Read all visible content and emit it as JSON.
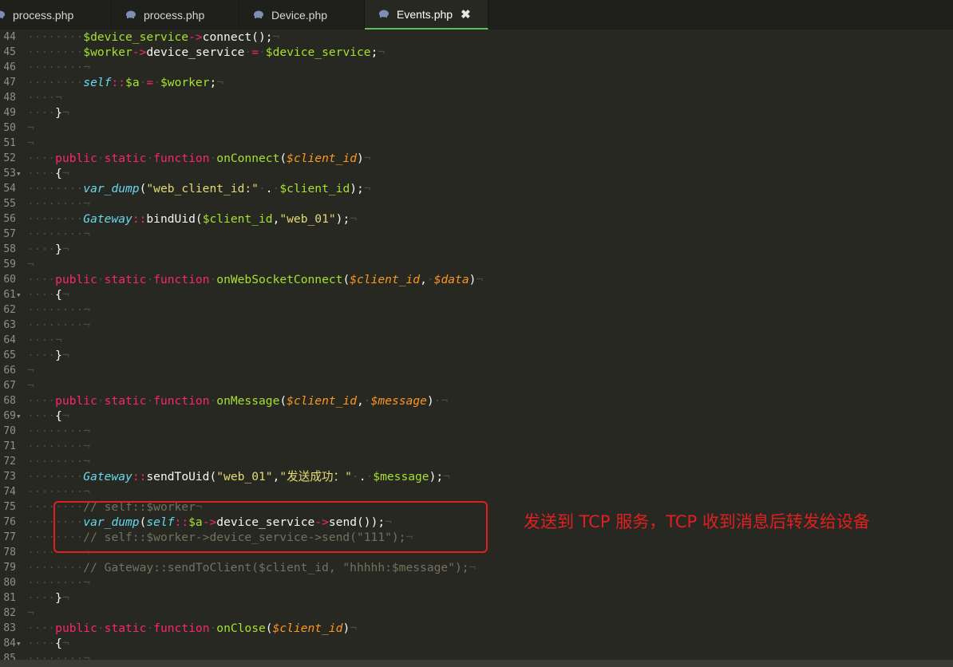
{
  "tabs": [
    {
      "label": "process.php",
      "active": false
    },
    {
      "label": "process.php",
      "active": false
    },
    {
      "label": "Device.php",
      "active": false
    },
    {
      "label": "Events.php",
      "active": true
    }
  ],
  "close_glyph": "✖",
  "annotation": "发送到 TCP 服务，TCP 收到消息后转发给设备",
  "colors": {
    "background": "#272822",
    "keyword": "#f92672",
    "function": "#a6e22e",
    "string": "#e6db74",
    "comment": "#75715e",
    "annotation": "#e02020",
    "active_tab_underline": "#5ac15a"
  },
  "lines": [
    {
      "n": "44",
      "fold": "",
      "segs": [
        [
          "ws",
          "········"
        ],
        [
          "var",
          "$device_service"
        ],
        [
          "op",
          "->"
        ],
        [
          "plain",
          "connect();"
        ],
        [
          "ws",
          "¬"
        ]
      ]
    },
    {
      "n": "45",
      "fold": "",
      "segs": [
        [
          "ws",
          "········"
        ],
        [
          "var",
          "$worker"
        ],
        [
          "op",
          "->"
        ],
        [
          "plain",
          "device_service"
        ],
        [
          "ws",
          "·"
        ],
        [
          "op",
          "="
        ],
        [
          "ws",
          "·"
        ],
        [
          "var",
          "$device_service"
        ],
        [
          "plain",
          ";"
        ],
        [
          "ws",
          "¬"
        ]
      ]
    },
    {
      "n": "46",
      "fold": "",
      "segs": [
        [
          "ws",
          "········¬"
        ]
      ]
    },
    {
      "n": "47",
      "fold": "",
      "segs": [
        [
          "ws",
          "········"
        ],
        [
          "st",
          "self"
        ],
        [
          "op",
          "::"
        ],
        [
          "var",
          "$a"
        ],
        [
          "ws",
          "·"
        ],
        [
          "op",
          "="
        ],
        [
          "ws",
          "·"
        ],
        [
          "var",
          "$worker"
        ],
        [
          "plain",
          ";"
        ],
        [
          "ws",
          "¬"
        ]
      ]
    },
    {
      "n": "48",
      "fold": "",
      "segs": [
        [
          "ws",
          "····¬"
        ]
      ]
    },
    {
      "n": "49",
      "fold": "",
      "segs": [
        [
          "ws",
          "····"
        ],
        [
          "plain",
          "}"
        ],
        [
          "ws",
          "¬"
        ]
      ]
    },
    {
      "n": "50",
      "fold": "",
      "segs": [
        [
          "ws",
          "¬"
        ]
      ]
    },
    {
      "n": "51",
      "fold": "",
      "segs": [
        [
          "ws",
          "¬"
        ]
      ]
    },
    {
      "n": "52",
      "fold": "",
      "segs": [
        [
          "ws",
          "····"
        ],
        [
          "kw",
          "public"
        ],
        [
          "ws",
          "·"
        ],
        [
          "kw",
          "static"
        ],
        [
          "ws",
          "·"
        ],
        [
          "kw",
          "function"
        ],
        [
          "ws",
          "·"
        ],
        [
          "fn",
          "onConnect"
        ],
        [
          "plain",
          "("
        ],
        [
          "ph",
          "$client_id"
        ],
        [
          "plain",
          ")"
        ],
        [
          "ws",
          "¬"
        ]
      ]
    },
    {
      "n": "53",
      "fold": "▾",
      "segs": [
        [
          "ws",
          "····"
        ],
        [
          "plain",
          "{"
        ],
        [
          "ws",
          "¬"
        ]
      ]
    },
    {
      "n": "54",
      "fold": "",
      "segs": [
        [
          "ws",
          "········"
        ],
        [
          "st",
          "var_dump"
        ],
        [
          "plain",
          "("
        ],
        [
          "str",
          "\"web_client_id:\""
        ],
        [
          "ws",
          "·"
        ],
        [
          "plain",
          "."
        ],
        [
          "ws",
          "·"
        ],
        [
          "var",
          "$client_id"
        ],
        [
          "plain",
          ");"
        ],
        [
          "ws",
          "¬"
        ]
      ]
    },
    {
      "n": "55",
      "fold": "",
      "segs": [
        [
          "ws",
          "········¬"
        ]
      ]
    },
    {
      "n": "56",
      "fold": "",
      "segs": [
        [
          "ws",
          "········"
        ],
        [
          "st",
          "Gateway"
        ],
        [
          "op",
          "::"
        ],
        [
          "plain",
          "bindUid("
        ],
        [
          "var",
          "$client_id"
        ],
        [
          "plain",
          ","
        ],
        [
          "str",
          "\"web_01\""
        ],
        [
          "plain",
          ");"
        ],
        [
          "ws",
          "¬"
        ]
      ]
    },
    {
      "n": "57",
      "fold": "",
      "segs": [
        [
          "ws",
          "········¬"
        ]
      ]
    },
    {
      "n": "58",
      "fold": "",
      "segs": [
        [
          "ws",
          "····"
        ],
        [
          "plain",
          "}"
        ],
        [
          "ws",
          "¬"
        ]
      ]
    },
    {
      "n": "59",
      "fold": "",
      "segs": [
        [
          "ws",
          "¬"
        ]
      ]
    },
    {
      "n": "60",
      "fold": "",
      "segs": [
        [
          "ws",
          "····"
        ],
        [
          "kw",
          "public"
        ],
        [
          "ws",
          "·"
        ],
        [
          "kw",
          "static"
        ],
        [
          "ws",
          "·"
        ],
        [
          "kw",
          "function"
        ],
        [
          "ws",
          "·"
        ],
        [
          "fn",
          "onWebSocketConnect"
        ],
        [
          "plain",
          "("
        ],
        [
          "ph",
          "$client_id"
        ],
        [
          "plain",
          ","
        ],
        [
          "ws",
          "·"
        ],
        [
          "ph",
          "$data"
        ],
        [
          "plain",
          ")"
        ],
        [
          "ws",
          "¬"
        ]
      ]
    },
    {
      "n": "61",
      "fold": "▾",
      "segs": [
        [
          "ws",
          "····"
        ],
        [
          "plain",
          "{"
        ],
        [
          "ws",
          "¬"
        ]
      ]
    },
    {
      "n": "62",
      "fold": "",
      "segs": [
        [
          "ws",
          "········¬"
        ]
      ]
    },
    {
      "n": "63",
      "fold": "",
      "segs": [
        [
          "ws",
          "········¬"
        ]
      ]
    },
    {
      "n": "64",
      "fold": "",
      "segs": [
        [
          "ws",
          "····¬"
        ]
      ]
    },
    {
      "n": "65",
      "fold": "",
      "segs": [
        [
          "ws",
          "····"
        ],
        [
          "plain",
          "}"
        ],
        [
          "ws",
          "¬"
        ]
      ]
    },
    {
      "n": "66",
      "fold": "",
      "segs": [
        [
          "ws",
          "¬"
        ]
      ]
    },
    {
      "n": "67",
      "fold": "",
      "segs": [
        [
          "ws",
          "¬"
        ]
      ]
    },
    {
      "n": "68",
      "fold": "",
      "segs": [
        [
          "ws",
          "····"
        ],
        [
          "kw",
          "public"
        ],
        [
          "ws",
          "·"
        ],
        [
          "kw",
          "static"
        ],
        [
          "ws",
          "·"
        ],
        [
          "kw",
          "function"
        ],
        [
          "ws",
          "·"
        ],
        [
          "fn",
          "onMessage"
        ],
        [
          "plain",
          "("
        ],
        [
          "ph",
          "$client_id"
        ],
        [
          "plain",
          ","
        ],
        [
          "ws",
          "·"
        ],
        [
          "ph",
          "$message"
        ],
        [
          "plain",
          ")"
        ],
        [
          "ws",
          "·¬"
        ]
      ]
    },
    {
      "n": "69",
      "fold": "▾",
      "segs": [
        [
          "ws",
          "····"
        ],
        [
          "plain",
          "{"
        ],
        [
          "ws",
          "¬"
        ]
      ]
    },
    {
      "n": "70",
      "fold": "",
      "segs": [
        [
          "ws",
          "········¬"
        ]
      ]
    },
    {
      "n": "71",
      "fold": "",
      "segs": [
        [
          "ws",
          "········¬"
        ]
      ]
    },
    {
      "n": "72",
      "fold": "",
      "segs": [
        [
          "ws",
          "········¬"
        ]
      ]
    },
    {
      "n": "73",
      "fold": "",
      "segs": [
        [
          "ws",
          "········"
        ],
        [
          "st",
          "Gateway"
        ],
        [
          "op",
          "::"
        ],
        [
          "plain",
          "sendToUid("
        ],
        [
          "str",
          "\"web_01\""
        ],
        [
          "plain",
          ","
        ],
        [
          "str",
          "\"发送成功：\""
        ],
        [
          "ws",
          "·"
        ],
        [
          "plain",
          "."
        ],
        [
          "ws",
          "·"
        ],
        [
          "var",
          "$message"
        ],
        [
          "plain",
          ");"
        ],
        [
          "ws",
          "¬"
        ]
      ]
    },
    {
      "n": "74",
      "fold": "",
      "segs": [
        [
          "ws",
          "········¬"
        ]
      ]
    },
    {
      "n": "75",
      "fold": "",
      "segs": [
        [
          "ws",
          "········"
        ],
        [
          "cm",
          "// self::$worker"
        ],
        [
          "ws",
          "¬"
        ]
      ]
    },
    {
      "n": "76",
      "fold": "",
      "segs": [
        [
          "ws",
          "········"
        ],
        [
          "st",
          "var_dump"
        ],
        [
          "plain",
          "("
        ],
        [
          "st",
          "self"
        ],
        [
          "op",
          "::"
        ],
        [
          "var",
          "$a"
        ],
        [
          "op",
          "->"
        ],
        [
          "plain",
          "device_service"
        ],
        [
          "op",
          "->"
        ],
        [
          "plain",
          "send());"
        ],
        [
          "ws",
          "¬"
        ]
      ]
    },
    {
      "n": "77",
      "fold": "",
      "segs": [
        [
          "ws",
          "········"
        ],
        [
          "cm",
          "// self::$worker->device_service->send(\"111\");"
        ],
        [
          "ws",
          "¬"
        ]
      ]
    },
    {
      "n": "78",
      "fold": "",
      "segs": [
        [
          "ws",
          "········¬"
        ]
      ]
    },
    {
      "n": "79",
      "fold": "",
      "segs": [
        [
          "ws",
          "········"
        ],
        [
          "cm",
          "// Gateway::sendToClient($client_id, \"hhhhh:$message\");"
        ],
        [
          "ws",
          "¬"
        ]
      ]
    },
    {
      "n": "80",
      "fold": "",
      "segs": [
        [
          "ws",
          "········¬"
        ]
      ]
    },
    {
      "n": "81",
      "fold": "",
      "segs": [
        [
          "ws",
          "····"
        ],
        [
          "plain",
          "}"
        ],
        [
          "ws",
          "¬"
        ]
      ]
    },
    {
      "n": "82",
      "fold": "",
      "segs": [
        [
          "ws",
          "¬"
        ]
      ]
    },
    {
      "n": "83",
      "fold": "",
      "segs": [
        [
          "ws",
          "····"
        ],
        [
          "kw",
          "public"
        ],
        [
          "ws",
          "·"
        ],
        [
          "kw",
          "static"
        ],
        [
          "ws",
          "·"
        ],
        [
          "kw",
          "function"
        ],
        [
          "ws",
          "·"
        ],
        [
          "fn",
          "onClose"
        ],
        [
          "plain",
          "("
        ],
        [
          "ph",
          "$client_id"
        ],
        [
          "plain",
          ")"
        ],
        [
          "ws",
          "¬"
        ]
      ]
    },
    {
      "n": "84",
      "fold": "▾",
      "segs": [
        [
          "ws",
          "····"
        ],
        [
          "plain",
          "{"
        ],
        [
          "ws",
          "¬"
        ]
      ]
    },
    {
      "n": "85",
      "fold": "",
      "segs": [
        [
          "ws",
          "········¬"
        ]
      ]
    }
  ]
}
